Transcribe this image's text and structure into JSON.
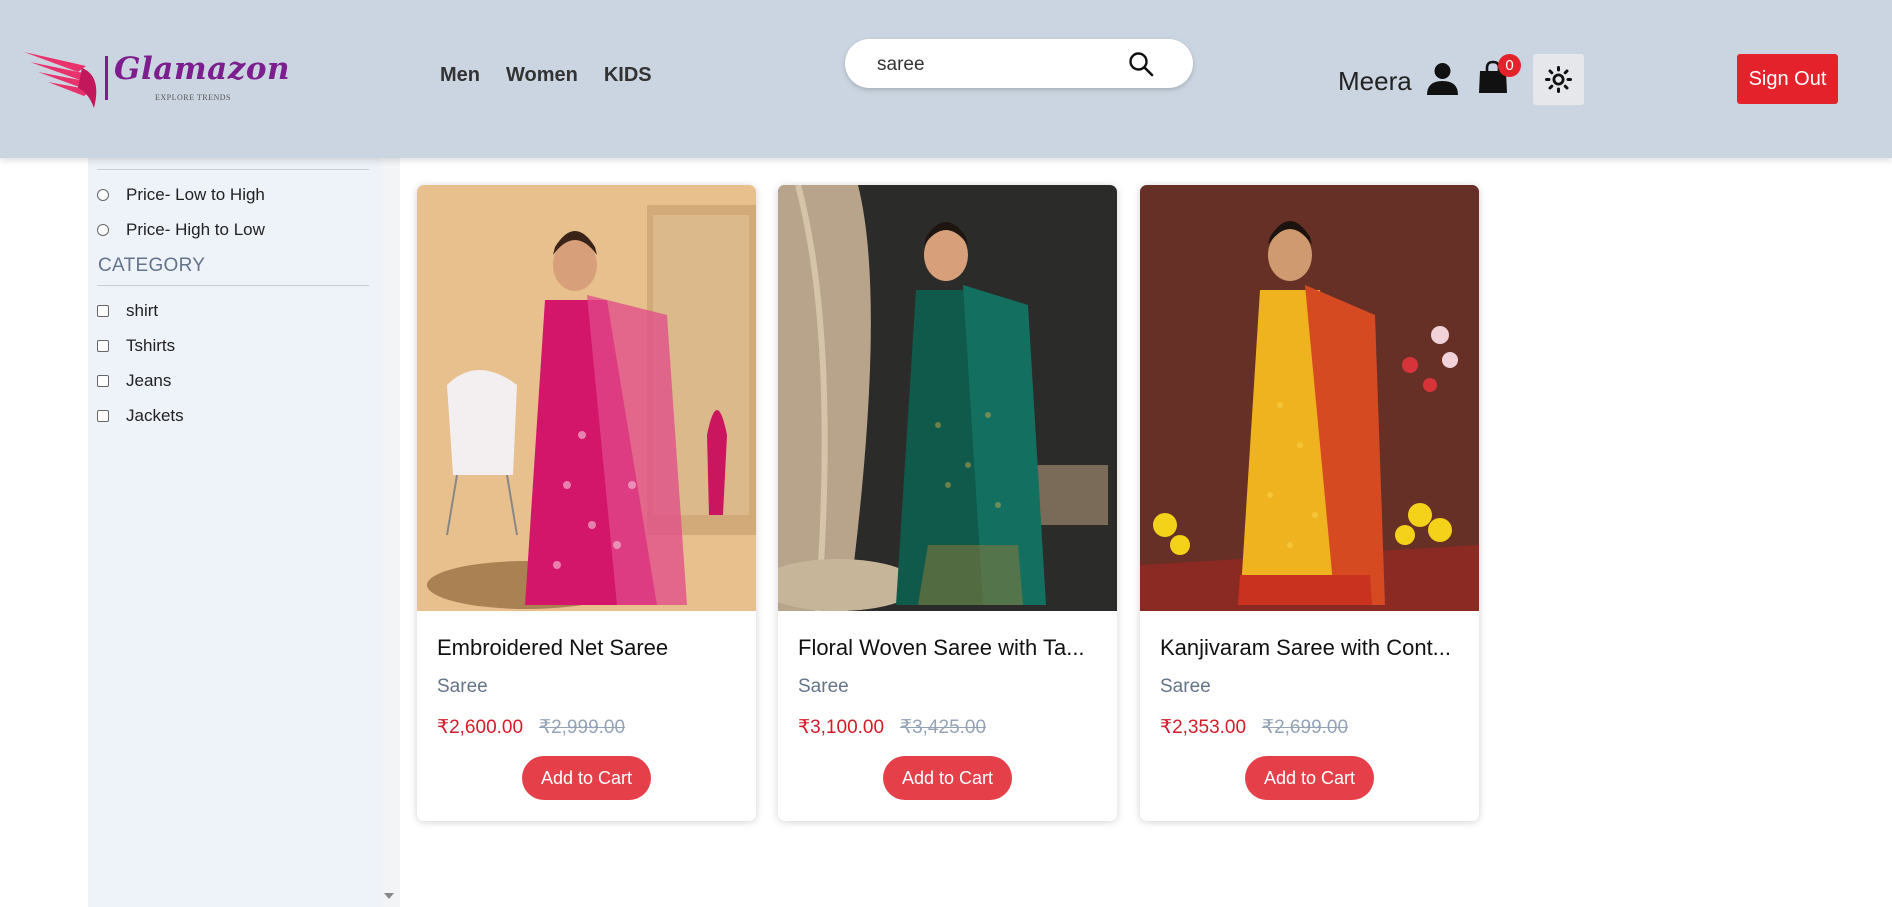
{
  "header": {
    "logo": {
      "name": "Glamazon",
      "tagline": "EXPLORE TRENDS"
    },
    "nav": [
      "Men",
      "Women",
      "KIDS"
    ],
    "search": {
      "value": "saree",
      "icon": "search-icon"
    },
    "user": {
      "name": "Meera",
      "icon": "user-icon"
    },
    "cart": {
      "count": "0",
      "icon": "shopping-bag-icon"
    },
    "theme_toggle": {
      "icon": "sun-icon"
    },
    "sign_out_label": "Sign Out"
  },
  "sidebar": {
    "sort_options": [
      "Price- Low to High",
      "Price- High to Low"
    ],
    "category_heading": "CATEGORY",
    "categories": [
      "shirt",
      "Tshirts",
      "Jeans",
      "Jackets"
    ]
  },
  "products": [
    {
      "name": "Embroidered Net Saree",
      "category": "Saree",
      "price": "₹2,600.00",
      "original_price": "₹2,999.00",
      "button": "Add to Cart"
    },
    {
      "name": "Floral Woven Saree with Ta...",
      "category": "Saree",
      "price": "₹3,100.00",
      "original_price": "₹3,425.00",
      "button": "Add to Cart"
    },
    {
      "name": "Kanjivaram Saree with Cont...",
      "category": "Saree",
      "price": "₹2,353.00",
      "original_price": "₹2,699.00",
      "button": "Add to Cart"
    }
  ],
  "colors": {
    "header_bg": "#cbd5e1",
    "accent_red": "#e3222b",
    "brand_purple": "#7c1e8e",
    "sidebar_bg": "#eef2f9"
  }
}
